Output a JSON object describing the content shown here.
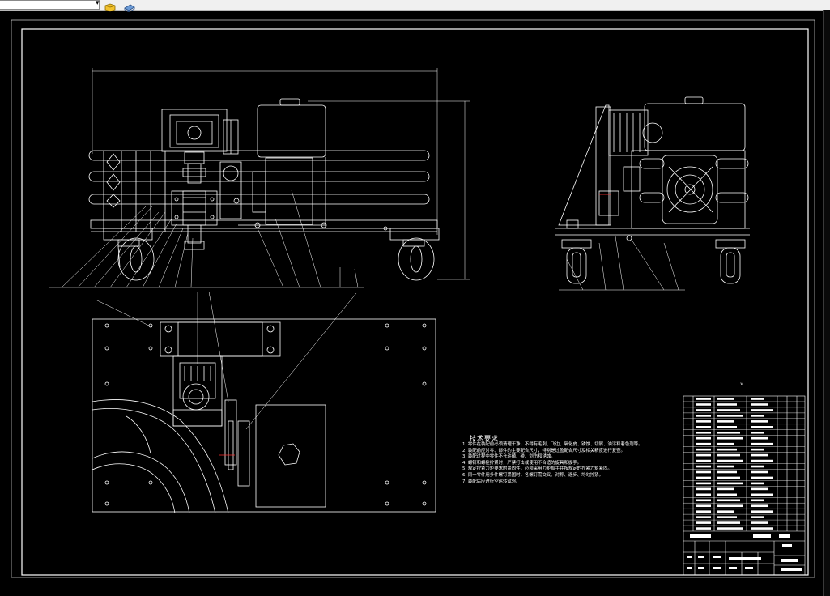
{
  "toolbar": {
    "dropdown_value": "",
    "icons": [
      "layer-dropdown-arrow-icon",
      "layer-state-icon",
      "layer-previous-icon"
    ]
  },
  "drawing": {
    "technical_requirements_title": "技术要求",
    "technical_requirements": [
      "1. 零件在装配前必须清理干净，不得有毛刺、飞边、氧化皮、锈蚀、切屑、油污和着色剂等。",
      "2. 装配前应对零、部件的主要配合尺寸，特别是过盈配合尺寸及相关精度进行复查。",
      "3. 装配过程中零件不允许磕、碰、划伤和锈蚀。",
      "4. 螺钉和螺栓拧紧时，严禁打击或使用不合适的旋具和扳手。",
      "5. 规定拧紧力矩要求的紧固件，必须采用力矩扳手并按规定的拧紧力矩紧固。",
      "6. 同一零件用多件螺钉紧固时，各螺钉需交叉、对称、逐步、均匀拧紧。",
      "7. 装配后应进行空运转试验。"
    ],
    "roughness_symbol": "√",
    "colors": {
      "background": "#000000",
      "line": "#ffffff",
      "toolbar": "#f0f0f0",
      "accent_red": "#ff3030"
    }
  }
}
